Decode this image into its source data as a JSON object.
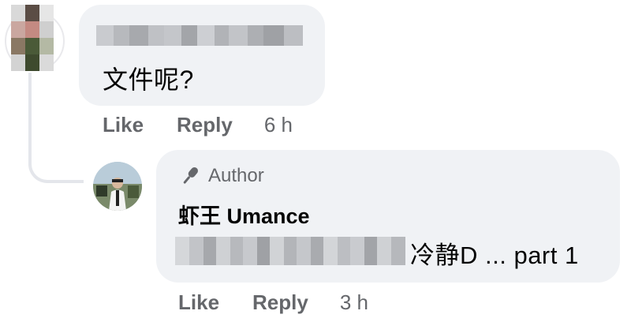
{
  "comment_1": {
    "text": "文件呢?",
    "actions": {
      "like": "Like",
      "reply": "Reply",
      "time": "6 h"
    }
  },
  "comment_2": {
    "badge": "Author",
    "author_name": "虾王 Umance",
    "text_visible": "冷静D ... part 1",
    "actions": {
      "like": "Like",
      "reply": "Reply",
      "time": "3 h"
    }
  },
  "colors": {
    "bubble": "#f0f2f5",
    "secondary_text": "#65676b",
    "primary_text": "#050505",
    "thread_line": "#e4e6eb"
  },
  "icons": {
    "author_badge": "microphone-icon"
  }
}
